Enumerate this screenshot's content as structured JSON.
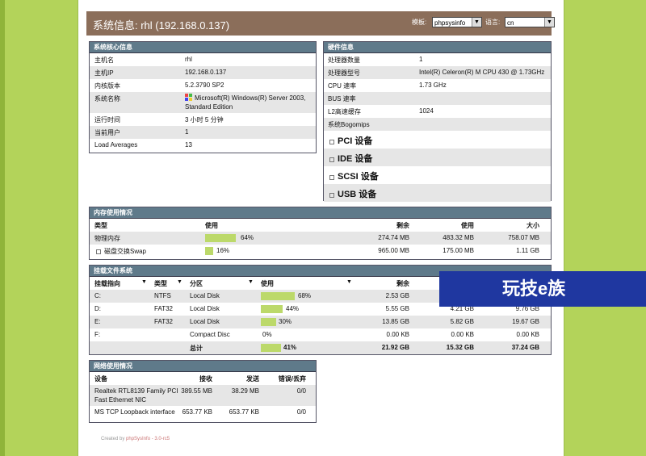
{
  "header": {
    "title": "系统信息: rhl (192.168.0.137)",
    "template_label": "模板:",
    "template_value": "phpsysinfo",
    "language_label": "语言:",
    "language_value": "cn"
  },
  "vitals": {
    "title": "系统核心信息",
    "rows": [
      {
        "label": "主机名",
        "value": "rhl"
      },
      {
        "label": "主机IP",
        "value": "192.168.0.137"
      },
      {
        "label": "内核版本",
        "value": "5.2.3790 SP2"
      },
      {
        "label": "系统名称",
        "value": "Microsoft(R) Windows(R) Server 2003,",
        "value2": "Standard Edition"
      },
      {
        "label": "运行时间",
        "value": "3 小时 5 分钟"
      },
      {
        "label": "当前用户",
        "value": "1"
      },
      {
        "label": "Load Averages",
        "value": "13"
      }
    ]
  },
  "hardware": {
    "title": "硬件信息",
    "rows": [
      {
        "label": "处理器数量",
        "value": "1"
      },
      {
        "label": "处理器型号",
        "value": "Intel(R) Celeron(R) M CPU 430 @ 1.73GHz"
      },
      {
        "label": "CPU 速率",
        "value": "1.73 GHz"
      },
      {
        "label": "BUS 速率",
        "value": ""
      },
      {
        "label": "L2高速缓存",
        "value": "1024"
      },
      {
        "label": "系统Bogomips",
        "value": ""
      }
    ],
    "devices": [
      "PCI 设备",
      "IDE 设备",
      "SCSI 设备",
      "USB 设备"
    ]
  },
  "memory": {
    "title": "内存使用情况",
    "headers": {
      "type": "类型",
      "usage": "使用",
      "free": "剩余",
      "used": "使用",
      "size": "大小"
    },
    "rows": [
      {
        "type": "物理内存",
        "percent": 64,
        "percent_label": "64%",
        "free": "274.74 MB",
        "used": "483.32 MB",
        "size": "758.07 MB"
      },
      {
        "type": "磁盘交换Swap",
        "percent": 16,
        "percent_label": "16%",
        "free": "965.00 MB",
        "used": "175.00 MB",
        "size": "1.11 GB"
      }
    ]
  },
  "filesystems": {
    "title": "挂载文件系统",
    "headers": {
      "mount": "挂载指向",
      "type": "类型",
      "partition": "分区",
      "usage": "使用",
      "free": "剩余"
    },
    "rows": [
      {
        "mount": "C:",
        "type": "NTFS",
        "partition": "Local Disk",
        "percent": 68,
        "percent_label": "68%",
        "free": "2.53 GB",
        "used": "",
        "size": ""
      },
      {
        "mount": "D:",
        "type": "FAT32",
        "partition": "Local Disk",
        "percent": 44,
        "percent_label": "44%",
        "free": "5.55 GB",
        "used": "4.21 GB",
        "size": "9.76 GB"
      },
      {
        "mount": "E:",
        "type": "FAT32",
        "partition": "Local Disk",
        "percent": 30,
        "percent_label": "30%",
        "free": "13.85 GB",
        "used": "5.82 GB",
        "size": "19.67 GB"
      },
      {
        "mount": "F:",
        "type": "",
        "partition": "Compact Disc",
        "percent": 0,
        "percent_label": "0%",
        "free": "0.00 KB",
        "used": "0.00 KB",
        "size": "0.00 KB"
      }
    ],
    "total": {
      "label": "总计",
      "percent": 41,
      "percent_label": "41%",
      "free": "21.92 GB",
      "used": "15.32 GB",
      "size": "37.24 GB"
    }
  },
  "network": {
    "title": "网络使用情况",
    "headers": {
      "device": "设备",
      "received": "接收",
      "sent": "发送",
      "errors": "错误/丢弃"
    },
    "rows": [
      {
        "device": "Realtek RTL8139 Family PCI",
        "device2": "Fast Ethernet NIC",
        "received": "389.55 MB",
        "sent": "38.29 MB",
        "errors": "0/0"
      },
      {
        "device": "MS TCP Loopback interface",
        "received": "653.77 KB",
        "sent": "653.77 KB",
        "errors": "0/0"
      }
    ]
  },
  "footer": {
    "prefix": "Created by",
    "link": "phpSysInfo - 3.0-rc5"
  },
  "watermark": "玩技e族"
}
